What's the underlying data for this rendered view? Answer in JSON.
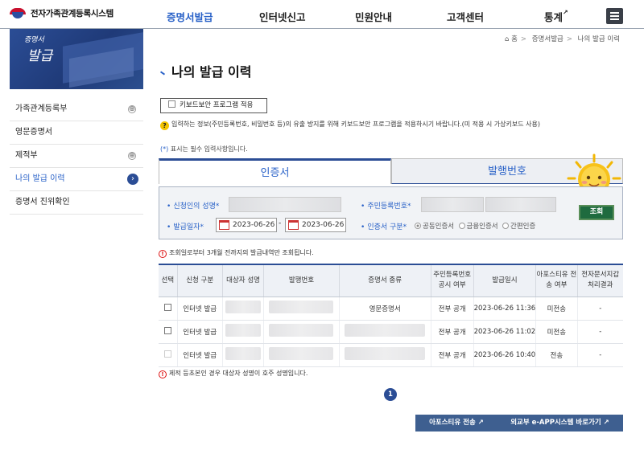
{
  "header": {
    "site_title": "전자가족관계등록시스템",
    "nav": [
      {
        "label": "증명서발급",
        "active": true
      },
      {
        "label": "인터넷신고"
      },
      {
        "label": "민원안내"
      },
      {
        "label": "고객센터"
      },
      {
        "label": "통계",
        "external_icon": "↗"
      }
    ],
    "menu_icon": "hamburger-icon"
  },
  "banner": {
    "line1": "증명서",
    "line2": "발급"
  },
  "sidebar": {
    "items": [
      {
        "label": "가족관계등록부",
        "icon": "⊕"
      },
      {
        "label": "영문증명서"
      },
      {
        "label": "제적부",
        "icon": "⊕"
      },
      {
        "label": "나의 발급 이력",
        "active": true,
        "icon": "›"
      },
      {
        "label": "증명서 진위확인"
      }
    ]
  },
  "breadcrumb": {
    "home_icon": "⌂",
    "items": [
      "홈",
      "증명서발급",
      "나의 발급 이력"
    ]
  },
  "page_title": "나의 발급 이력",
  "keyboard_security": {
    "label": "키보드보안 프로그램 적용"
  },
  "notice": {
    "icon": "?",
    "text": "입력하는 정보(주민등록번호, 비밀번호 등)의 유출 방지를 위해 키보드보안 프로그램을 적용하시기 바랍니다.(미 적용 시 가상키보드 사용)"
  },
  "required_note": {
    "star": "(*)",
    "text": "표시는 필수 입력사항입니다."
  },
  "tabs": [
    {
      "label": "인증서",
      "active": true
    },
    {
      "label": "발행번호"
    }
  ],
  "form": {
    "applicant_name_label": "신청인의 성명",
    "resident_number_label": "주민등록번호",
    "issue_date_label": "발급일자",
    "date_from": "2023-06-26",
    "date_separator": "-",
    "date_to": "2023-06-26",
    "cert_type_label": "인증서 구분",
    "cert_options": [
      "공동인증서",
      "금융인증서",
      "간편인증"
    ],
    "selected_cert": "공동인증서",
    "required_mark": "*",
    "search_button": "조회"
  },
  "info_warning": "조회일로부터 3개월 전까지의 발급내역만 조회됩니다.",
  "table": {
    "headers": [
      "선택",
      "신청 구분",
      "대상자 성명",
      "발행번호",
      "증명서 종류",
      "주민등록번호 공시 여부",
      "발급일시",
      "아포스티유 전송 여부",
      "전자문서지갑 처리결과"
    ],
    "rows": [
      {
        "type": "인터넷 발급",
        "cert": "영문증명서",
        "rrn_disclosure": "전부 공개",
        "issued_at": "2023-06-26 11:36",
        "apostille": "미전송",
        "wallet": "-"
      },
      {
        "type": "인터넷 발급",
        "cert": "",
        "rrn_disclosure": "전부 공개",
        "issued_at": "2023-06-26 11:02",
        "apostille": "미전송",
        "wallet": "-"
      },
      {
        "type": "인터넷 발급",
        "cert": "",
        "rrn_disclosure": "전부 공개",
        "issued_at": "2023-06-26 10:40",
        "apostille": "전송",
        "wallet": "-"
      }
    ]
  },
  "bottom_warning": "제적 등초본인 경우 대상자 성명이 호주 성명입니다.",
  "pagination": {
    "current": "1"
  },
  "buttons": {
    "apostille": "아포스티유 전송",
    "eapp": "외교부 e-APP시스템 바로가기",
    "external_icon": "↗"
  }
}
